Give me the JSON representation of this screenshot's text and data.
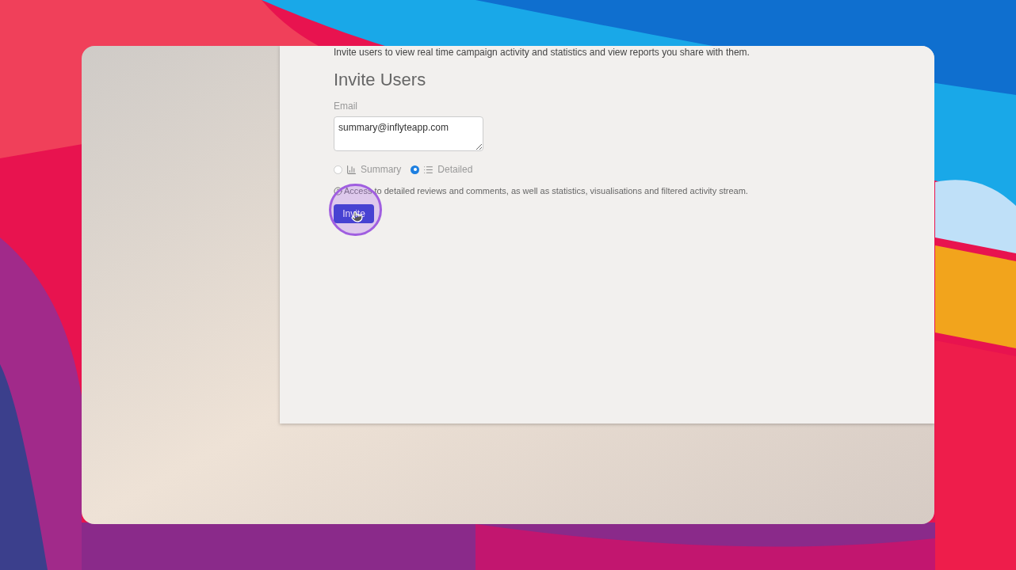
{
  "intro": "Invite users to view real time campaign activity and statistics and view reports you share with them.",
  "heading": "Invite Users",
  "email": {
    "label": "Email",
    "value": "summary@inflyteapp.com"
  },
  "report_types": [
    {
      "kind": "summary",
      "label": "Summary",
      "selected": false
    },
    {
      "kind": "detailed",
      "label": "Detailed",
      "selected": true
    }
  ],
  "help": "Access to detailed reviews and comments, as well as statistics, visualisations and filtered activity stream.",
  "invite_button": "Invite"
}
